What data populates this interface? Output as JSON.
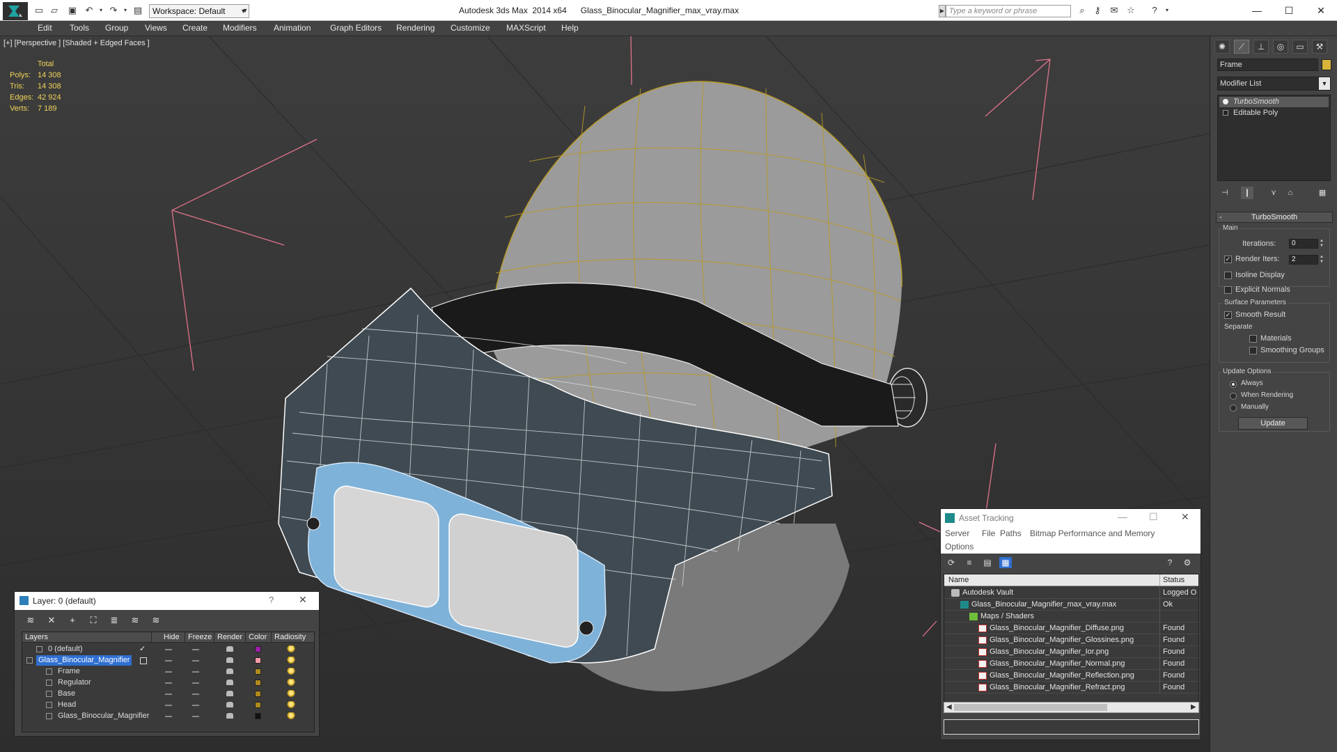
{
  "titlebar": {
    "title": "Autodesk 3ds Max  2014 x64      Glass_Binocular_Magnifier_max_vray.max",
    "workspace": "Workspace: Default",
    "search_placeholder": "Type a keyword or phrase"
  },
  "menu": [
    "Edit",
    "Tools",
    "Group",
    "Views",
    "Create",
    "Modifiers",
    "Animation",
    "Graph Editors",
    "Rendering",
    "Customize",
    "MAXScript",
    "Help"
  ],
  "viewport": {
    "label": "[+] [Perspective ] [Shaded + Edged Faces ]",
    "stats_header": "Total",
    "stats": [
      {
        "k": "Polys:",
        "v": "14 308"
      },
      {
        "k": "Tris:",
        "v": "14 308"
      },
      {
        "k": "Edges:",
        "v": "42 924"
      },
      {
        "k": "Verts:",
        "v": "7 189"
      }
    ]
  },
  "command_panel": {
    "object_name": "Frame",
    "object_color": "#d9b33a",
    "modifier_list": "Modifier List",
    "stack": [
      "TurboSmooth",
      "Editable Poly"
    ],
    "rollout_title": "TurboSmooth",
    "main_group": "Main",
    "iterations_label": "Iterations:",
    "iterations_value": "0",
    "render_iters_label": "Render Iters:",
    "render_iters_value": "2",
    "isoline": "Isoline Display",
    "explicit_normals": "Explicit Normals",
    "surface_group": "Surface Parameters",
    "smooth_result": "Smooth Result",
    "separate": "Separate",
    "materials": "Materials",
    "smoothing_groups": "Smoothing Groups",
    "update_group": "Update Options",
    "always": "Always",
    "when_rendering": "When Rendering",
    "manually": "Manually",
    "update_button": "Update"
  },
  "layer_window": {
    "title": "Layer: 0 (default)",
    "help": "?",
    "columns": [
      "Layers",
      "Hide",
      "Freeze",
      "Render",
      "Color",
      "Radiosity"
    ],
    "rows": [
      {
        "name": "0 (default)",
        "indent": 1,
        "color": "#9b1fa8",
        "selected": false
      },
      {
        "name": "Glass_Binocular_Magnifier",
        "indent": 0,
        "color": "#ff9aa6",
        "selected": true
      },
      {
        "name": "Frame",
        "indent": 2,
        "color": "#b08a1e",
        "selected": false
      },
      {
        "name": "Regulator",
        "indent": 2,
        "color": "#b08a1e",
        "selected": false
      },
      {
        "name": "Base",
        "indent": 2,
        "color": "#b08a1e",
        "selected": false
      },
      {
        "name": "Head",
        "indent": 2,
        "color": "#b08a1e",
        "selected": false
      },
      {
        "name": "Glass_Binocular_Magnifier",
        "indent": 2,
        "color": "#111111",
        "selected": false
      }
    ]
  },
  "asset_window": {
    "title": "Asset Tracking",
    "menu": [
      "Server",
      "File",
      "Paths",
      "Bitmap Performance and Memory",
      "Options"
    ],
    "columns": [
      "Name",
      "Status"
    ],
    "rows": [
      {
        "name": "Autodesk Vault",
        "status": "Logged O",
        "indent": 0,
        "icon": "vault"
      },
      {
        "name": "Glass_Binocular_Magnifier_max_vray.max",
        "status": "Ok",
        "indent": 1,
        "icon": "max"
      },
      {
        "name": "Maps / Shaders",
        "status": "",
        "indent": 2,
        "icon": "maps"
      },
      {
        "name": "Glass_Binocular_Magnifier_Diffuse.png",
        "status": "Found",
        "indent": 3,
        "icon": "png"
      },
      {
        "name": "Glass_Binocular_Magnifier_Glossines.png",
        "status": "Found",
        "indent": 3,
        "icon": "png"
      },
      {
        "name": "Glass_Binocular_Magnifier_Ior.png",
        "status": "Found",
        "indent": 3,
        "icon": "png"
      },
      {
        "name": "Glass_Binocular_Magnifier_Normal.png",
        "status": "Found",
        "indent": 3,
        "icon": "png"
      },
      {
        "name": "Glass_Binocular_Magnifier_Reflection.png",
        "status": "Found",
        "indent": 3,
        "icon": "png"
      },
      {
        "name": "Glass_Binocular_Magnifier_Refract.png",
        "status": "Found",
        "indent": 3,
        "icon": "png"
      }
    ]
  }
}
